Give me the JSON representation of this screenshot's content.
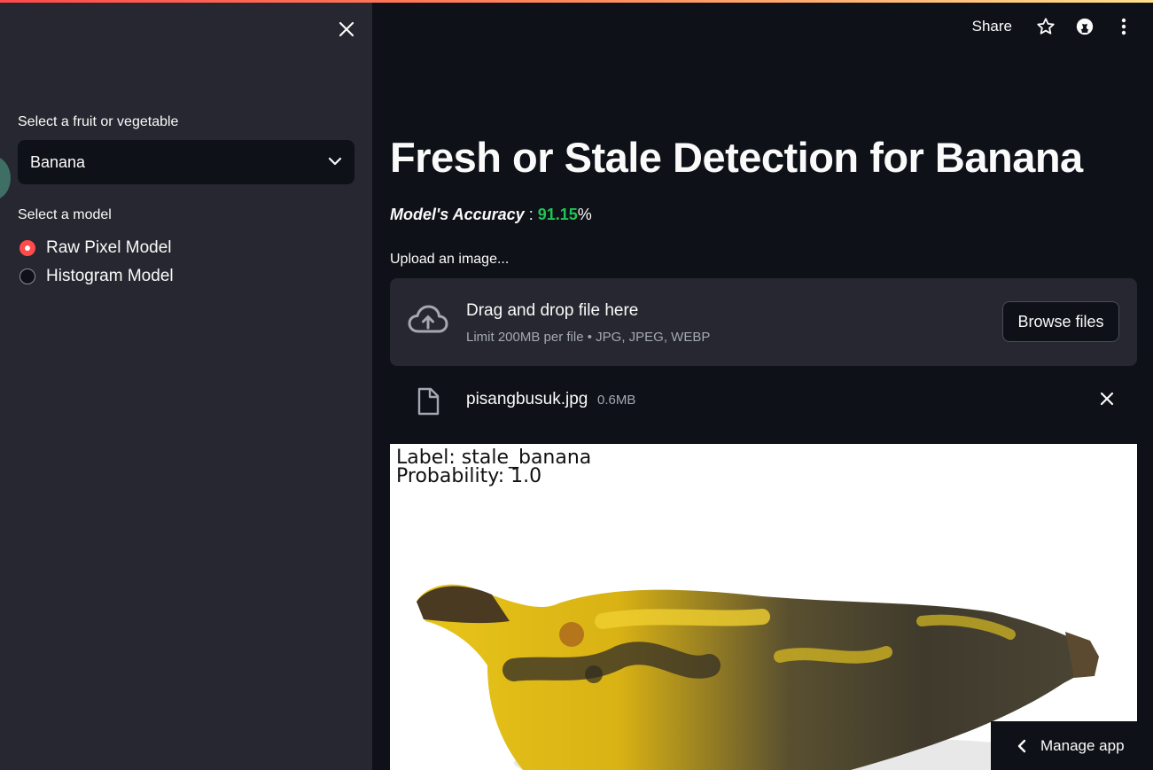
{
  "sidebar": {
    "select_label": "Select a fruit or vegetable",
    "selected_item": "Banana",
    "model_label": "Select a model",
    "models": [
      {
        "label": "Raw Pixel Model",
        "selected": true
      },
      {
        "label": "Histogram Model",
        "selected": false
      }
    ]
  },
  "header": {
    "share_label": "Share"
  },
  "main": {
    "title": "Fresh or Stale Detection for Banana",
    "accuracy_label": "Model's Accuracy",
    "accuracy_sep": " : ",
    "accuracy_value": "91.15",
    "accuracy_unit": "%",
    "upload_label": "Upload an image...",
    "uploader": {
      "drag_text": "Drag and drop file here",
      "limit_text": "Limit 200MB per file • JPG, JPEG, WEBP",
      "browse_label": "Browse files"
    },
    "file": {
      "name": "pisangbusuk.jpg",
      "size": "0.6MB"
    },
    "result": {
      "label_line": "Label: stale_banana",
      "probability_line": "Probability: 1.0"
    }
  },
  "footer": {
    "manage_label": "Manage app"
  },
  "colors": {
    "accent": "#ff4b4b",
    "accuracy_green": "#21c354",
    "background": "#0e1117",
    "sidebar": "#262730"
  }
}
